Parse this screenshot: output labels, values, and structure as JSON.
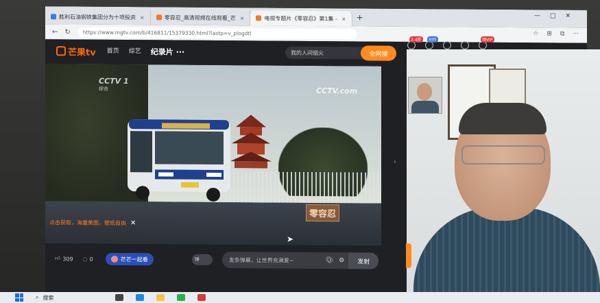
{
  "browser": {
    "tabs": [
      {
        "label": "胜利石油钢铁集团分为十项投资",
        "active": false
      },
      {
        "label": "零容忍_高清视频在线观看_芒",
        "active": false
      },
      {
        "label": "电视专题片《零容忍》第1集 -",
        "active": true
      }
    ],
    "new_tab": "+",
    "url": "https://www.mgtv.com/b/416811/15379330.html?lastp=v_plogdtl"
  },
  "site": {
    "logo": "芒果tv",
    "nav": [
      "首页",
      "综艺",
      "纪录片 ···"
    ],
    "search_placeholder": "我的人间烟火",
    "search_button": "全网搜",
    "badges": {
      "vip": "3.4折",
      "create": "创作",
      "history": "领VIP"
    }
  },
  "video": {
    "channel_logo": "CCTV 1",
    "channel_sub": "综合",
    "watermark_logo": "CCTV.com",
    "title_stamp": "零容忍",
    "promo_text": "点击获取，海量美图，壁纸自由"
  },
  "controls": {
    "likes": "309",
    "comments": "0",
    "together_label": "芒芒一起看",
    "danmaku_toggle": "弹",
    "danmaku_placeholder": "发条弹幕，让世界充满爱~",
    "send_button": "发射"
  },
  "taskbar": {
    "search_label": "搜索"
  },
  "colors": {
    "brand": "#ff8a1e",
    "together": "#2a4fb8"
  }
}
